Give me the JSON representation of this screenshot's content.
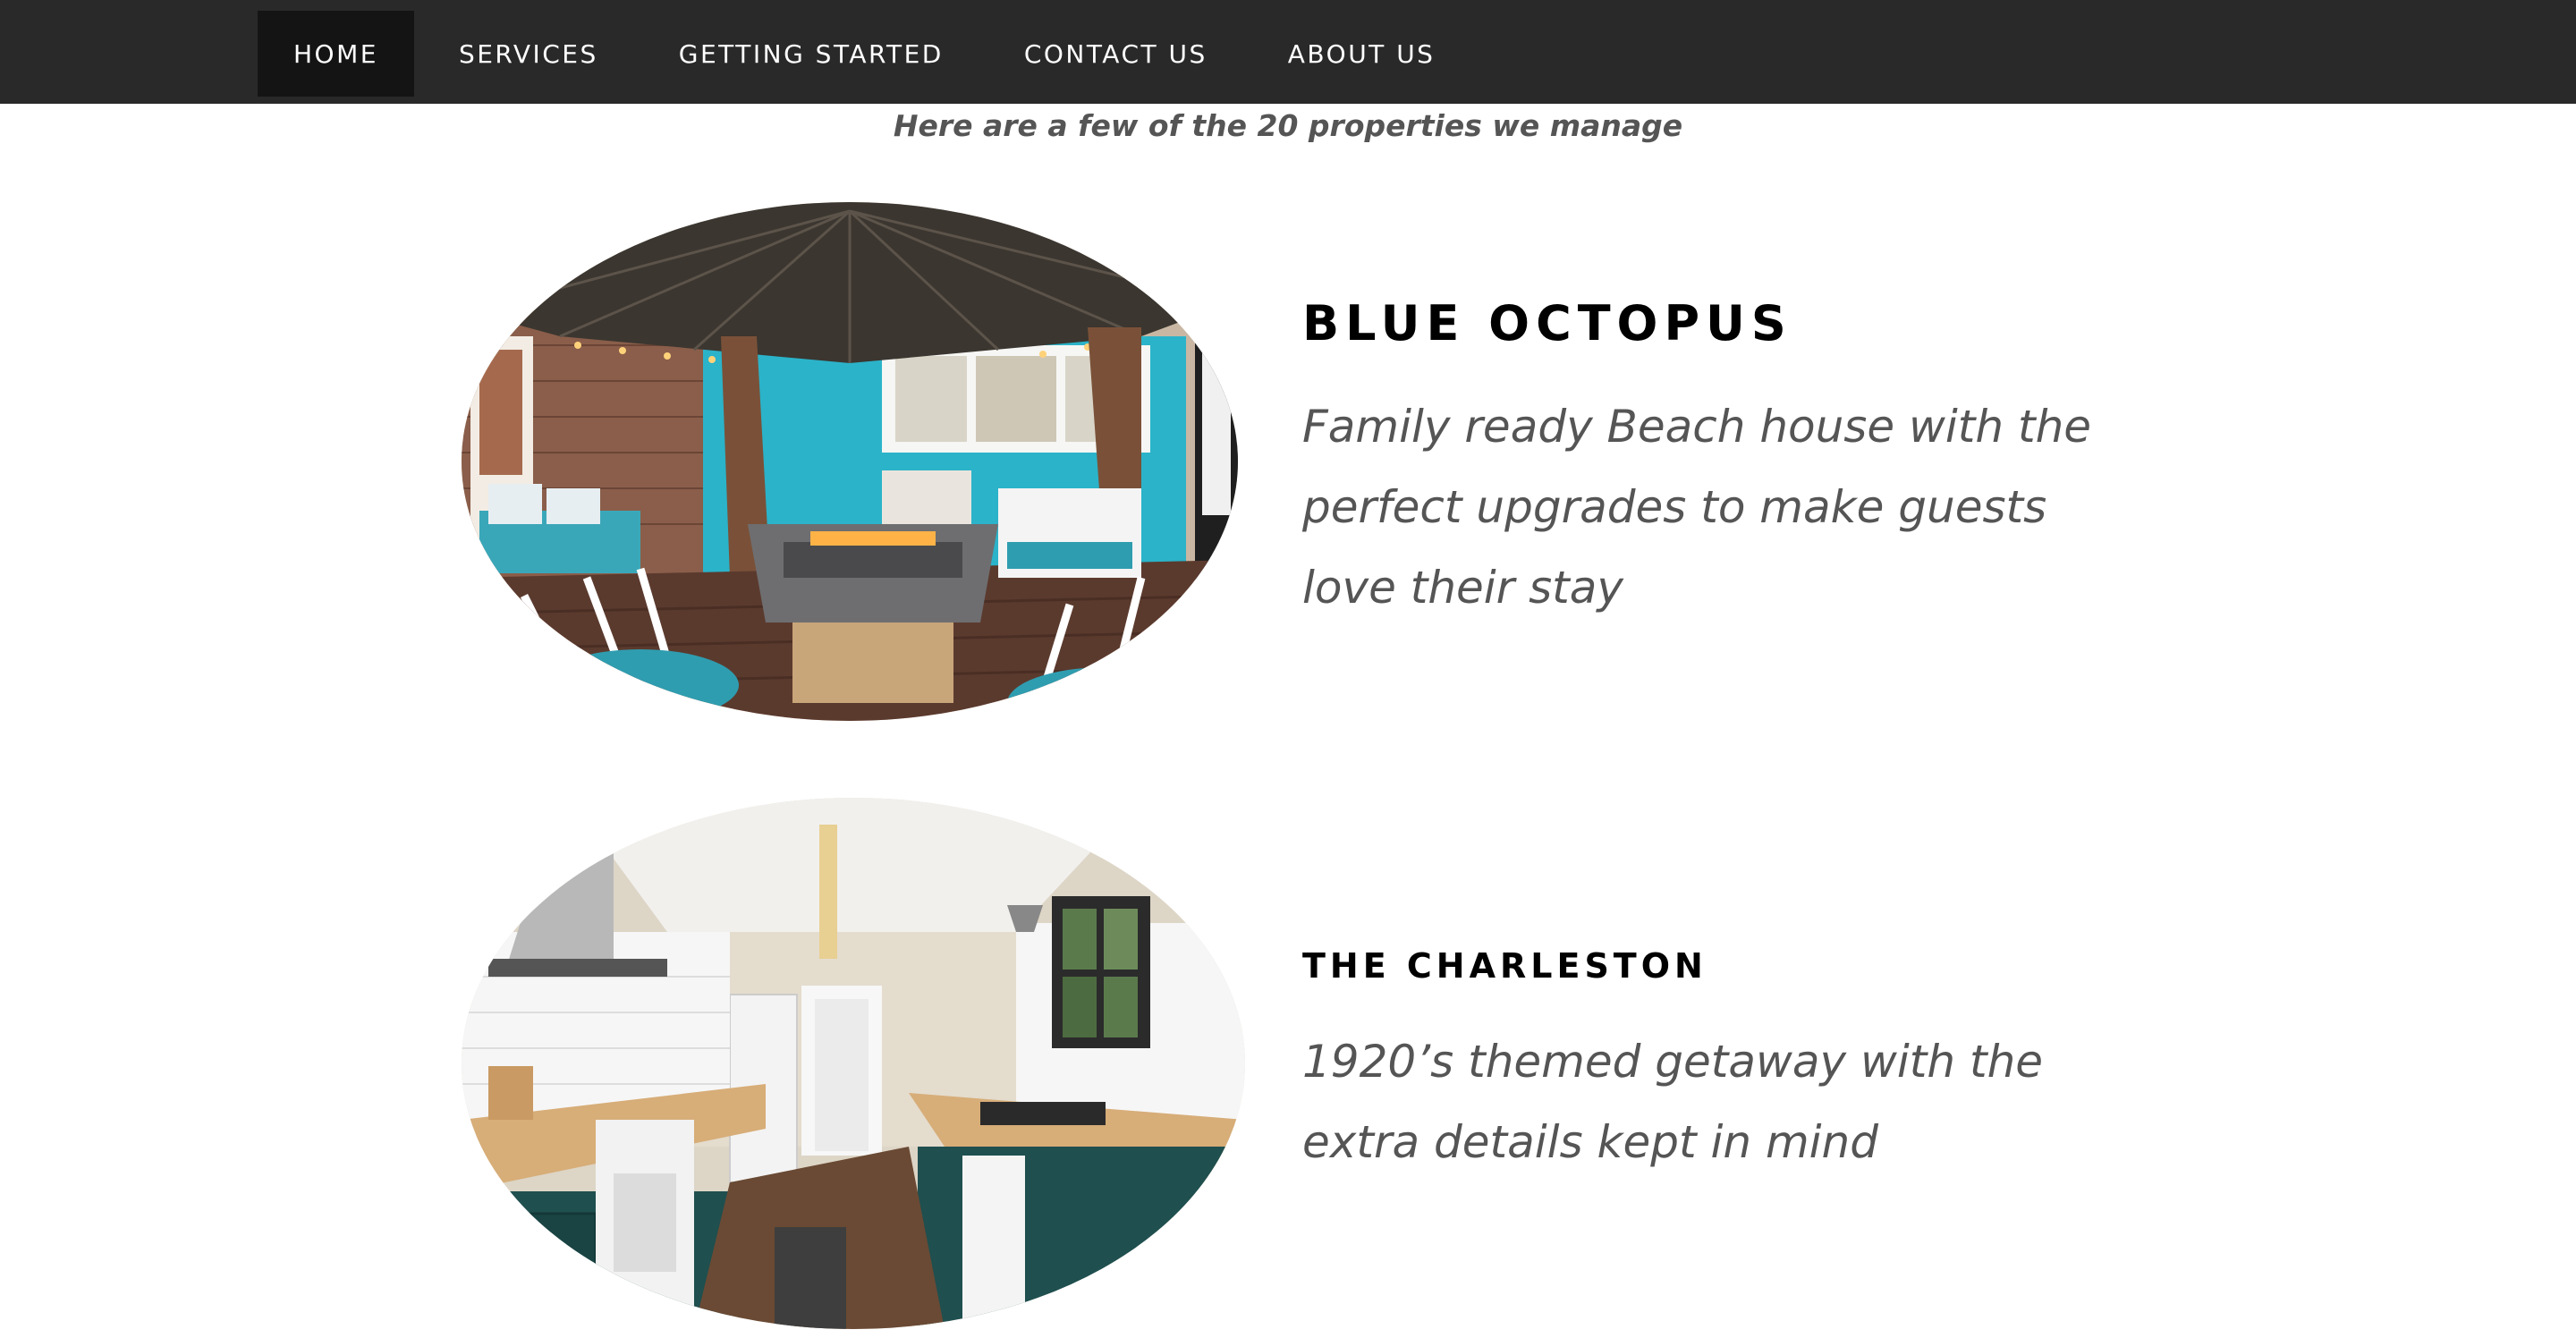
{
  "nav": {
    "items": [
      {
        "label": "HOME",
        "active": true
      },
      {
        "label": "SERVICES",
        "active": false
      },
      {
        "label": "GETTING STARTED",
        "active": false
      },
      {
        "label": "CONTACT US",
        "active": false
      },
      {
        "label": "ABOUT US",
        "active": false
      }
    ]
  },
  "intro": {
    "text": "Here are a few of the 20 properties we manage"
  },
  "properties": [
    {
      "title": "BLUE OCTOPUS",
      "description": "Family ready Beach house with the perfect upgrades to make guests love their stay"
    },
    {
      "title": "THE CHARLESTON",
      "description": "1920’s themed getaway with the extra details kept in mind"
    }
  ],
  "colors": {
    "nav_bg": "#292929",
    "nav_active_bg": "#141414",
    "nav_text": "#ffffff",
    "body_text": "#555555",
    "title_text": "#000000",
    "accent_teal": "#2bb3c9"
  }
}
